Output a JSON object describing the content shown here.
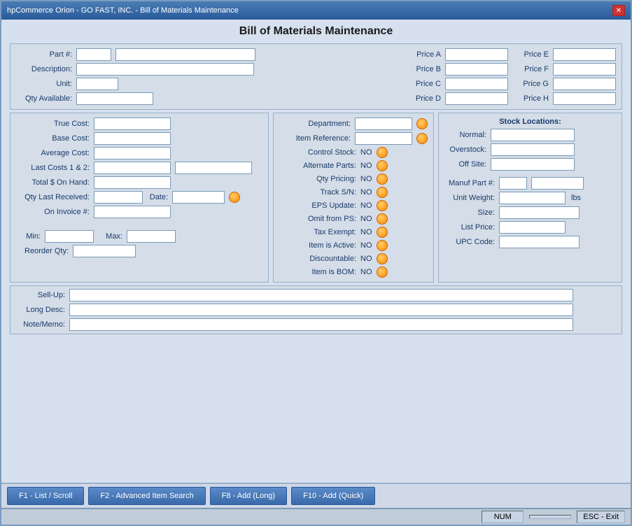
{
  "window": {
    "title": "hpCommerce Orion - GO FAST, INC. - Bill of Materials Maintenance",
    "close_btn": "✕"
  },
  "page": {
    "title": "Bill of Materials Maintenance"
  },
  "form": {
    "fields": {
      "part_num_label": "Part #:",
      "description_label": "Description:",
      "unit_label": "Unit:",
      "qty_available_label": "Qty Available:",
      "true_cost_label": "True Cost:",
      "base_cost_label": "Base Cost:",
      "average_cost_label": "Average Cost:",
      "last_costs_label": "Last Costs 1 & 2:",
      "total_s_on_hand_label": "Total $ On Hand:",
      "qty_last_received_label": "Qty Last Received:",
      "date_label": "Date:",
      "on_invoice_label": "On Invoice #:",
      "min_label": "Min:",
      "max_label": "Max:",
      "reorder_qty_label": "Reorder Qty:",
      "sell_up_label": "Sell-Up:",
      "long_desc_label": "Long Desc:",
      "note_memo_label": "Note/Memo:",
      "price_a_label": "Price A",
      "price_b_label": "Price B",
      "price_c_label": "Price C",
      "price_d_label": "Price D",
      "price_e_label": "Price E",
      "price_f_label": "Price F",
      "price_g_label": "Price G",
      "price_h_label": "Price H",
      "department_label": "Department:",
      "item_reference_label": "Item Reference:",
      "control_stock_label": "Control Stock:",
      "alternate_parts_label": "Alternate Parts:",
      "qty_pricing_label": "Qty Pricing:",
      "track_sn_label": "Track S/N:",
      "eps_update_label": "EPS Update:",
      "omit_from_ps_label": "Omit from PS:",
      "tax_exempt_label": "Tax Exempt:",
      "item_is_active_label": "Item is Active:",
      "discountable_label": "Discountable:",
      "item_is_bom_label": "Item is BOM:",
      "stock_locations_label": "Stock Locations:",
      "normal_label": "Normal:",
      "overstock_label": "Overstock:",
      "off_site_label": "Off Site:",
      "manuf_part_label": "Manuf Part #:",
      "unit_weight_label": "Unit Weight:",
      "lbs_label": "lbs",
      "size_label": "Size:",
      "list_price_label": "List Price:",
      "upc_code_label": "UPC Code:",
      "no_text": "NO"
    }
  },
  "buttons": {
    "f1_label": "F1 - List / Scroll",
    "f2_label": "F2 - Advanced Item Search",
    "f8_label": "F8 - Add (Long)",
    "f10_label": "F10 - Add (Quick)",
    "esc_label": "ESC - Exit"
  },
  "status": {
    "num_label": "NUM"
  }
}
